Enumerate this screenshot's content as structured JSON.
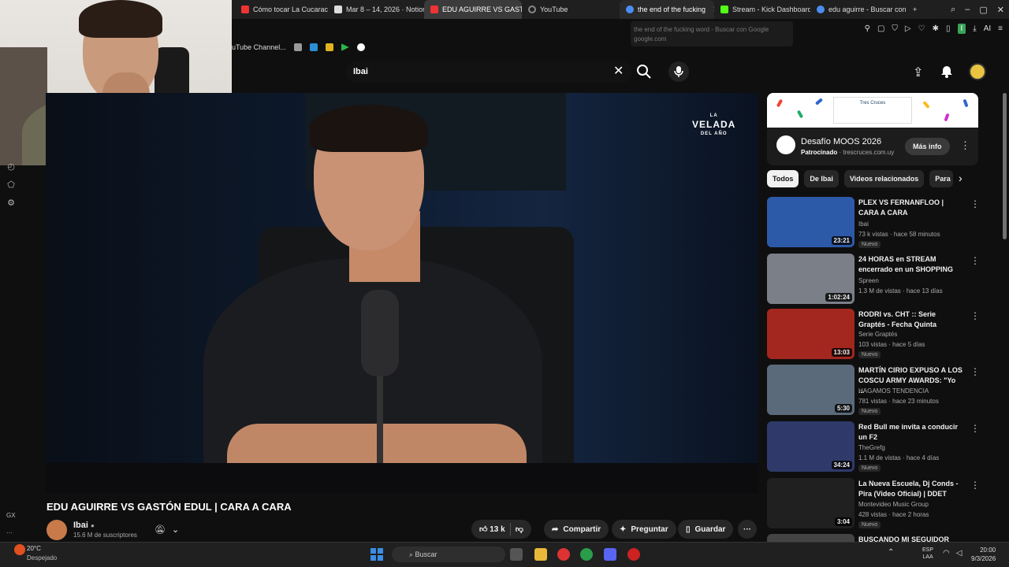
{
  "browser": {
    "tabs": [
      {
        "label": "Cómo tocar La Cucarach",
        "color": "#e33"
      },
      {
        "label": "Mar 8 – 14, 2026 · Notion",
        "color": "#ddd"
      },
      {
        "label": "EDU AGUIRRE VS GASTÓ",
        "color": "#e33"
      },
      {
        "label": "YouTube",
        "color": "#888"
      },
      {
        "label": "the end of the fucking",
        "color": "#4a8ef0"
      },
      {
        "label": "Stream - Kick Dashboard",
        "color": "#53fc18"
      },
      {
        "label": "edu aguirre - Buscar con",
        "color": "#4a8ef0"
      }
    ],
    "new_tab": "+",
    "tooltip_title": "the end of the fucking word - Buscar con Google",
    "tooltip_url": "google.com",
    "bookmark_label": "uTube Channel...",
    "toolbar_ai": "AI",
    "toolbar_profile": "I"
  },
  "youtube": {
    "search_value": "Ibai",
    "video_logo_line1": "LA",
    "video_logo_line2": "VELADA",
    "video_logo_line3": "DEL AÑO",
    "video_title": "EDU AGUIRRE VS GASTÓN EDUL | CARA A CARA",
    "channel_name": "Ibai",
    "channel_subs": "15.6 M de suscriptores",
    "likes": "13 k",
    "share_label": "Compartir",
    "ask_label": "Preguntar",
    "save_label": "Guardar",
    "rail_bottom": "GX"
  },
  "ad": {
    "banner_text": "Tres Cruces",
    "title": "Desafío MOOS 2026",
    "sponsored": "Patrocinado",
    "domain": "trescruces.com.uy",
    "button": "Más info"
  },
  "chips": [
    "Todos",
    "De Ibai",
    "Videos relacionados",
    "Para"
  ],
  "recs": [
    {
      "title": "PLEX VS FERNANFLOO | CARA A CARA",
      "channel": "Ibai",
      "meta": "73 k vistas · hace 58 minutos",
      "badge": "Nuevo",
      "duration": "23:21",
      "thumb": "#2d5aa8"
    },
    {
      "title": "24 HORAS en STREAM encerrado en un SHOPPING",
      "channel": "Spreen",
      "meta": "1.3 M de vistas · hace 13 días",
      "badge": "",
      "duration": "1:02:24",
      "thumb": "#7a7f88"
    },
    {
      "title": "RODRI vs. CHT :: Serie Graptés - Fecha Quinta",
      "channel": "Serie Graptés",
      "meta": "103 vistas · hace 5 días",
      "badge": "Nuevo",
      "duration": "13:03",
      "thumb": "#a3261f"
    },
    {
      "title": "MARTÍN CIRIO EXPUSO A LOS COSCU ARMY AWARDS: \"Yo ...",
      "channel": "HAGAMOS TENDENCIA",
      "meta": "781 vistas · hace 23 minutos",
      "badge": "Nuevo",
      "duration": "5:30",
      "thumb": "#5a6a7a"
    },
    {
      "title": "Red Bull me invita a conducir un F2",
      "channel": "TheGrefg",
      "meta": "1.1 M de vistas · hace 4 días",
      "badge": "Nuevo",
      "duration": "34:24",
      "thumb": "#2f3a6a"
    },
    {
      "title": "La Nueva Escuela, Dj Conds - Pira (Video Oficial) | DDET",
      "channel": "Montevideo Music Group",
      "meta": "428 vistas · hace 2 horas",
      "badge": "Nuevo",
      "duration": "3:04",
      "thumb": "#202020"
    },
    {
      "title": "BUSCANDO MI SEGUIDOR MÁS",
      "channel": "",
      "meta": "",
      "badge": "",
      "duration": "",
      "thumb": "#444"
    }
  ],
  "taskbar": {
    "temp": "20°C",
    "weather": "Despejado",
    "search": "Buscar",
    "lang1": "ESP",
    "lang2": "LAA",
    "time": "20:00",
    "date": "9/3/2026"
  }
}
